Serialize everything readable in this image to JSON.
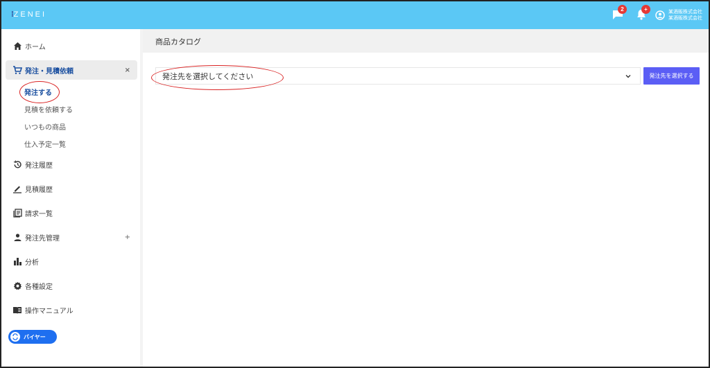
{
  "header": {
    "logo_text": "ZENEI",
    "messages_badge": "2",
    "notifications_badge": "+",
    "company_line1": "某酒販株式会社",
    "company_line2": "某酒販株式会社"
  },
  "sidebar": {
    "home": "ホーム",
    "order_quote": "発注・見積依頼",
    "order_quote_toggle": "×",
    "sub_items": {
      "order": "発注する",
      "request_quote": "見積を依頼する",
      "usual_products": "いつもの商品",
      "purchase_schedule": "仕入予定一覧"
    },
    "order_history": "発注履歴",
    "quote_history": "見積履歴",
    "invoice_list": "請求一覧",
    "supplier_mgmt": "発注先管理",
    "supplier_toggle": "+",
    "analysis": "分析",
    "settings": "各種設定",
    "manual": "操作マニュアル",
    "role": "バイヤー"
  },
  "main": {
    "title": "商品カタログ",
    "select_value": "発注先を選択してください",
    "select_button": "発注先を選択する"
  },
  "colors": {
    "header": "#5bc8f5",
    "accent": "#5b5ef5",
    "role_pill": "#1e6ff0",
    "badge": "#e53935",
    "annotation": "#d92020"
  }
}
